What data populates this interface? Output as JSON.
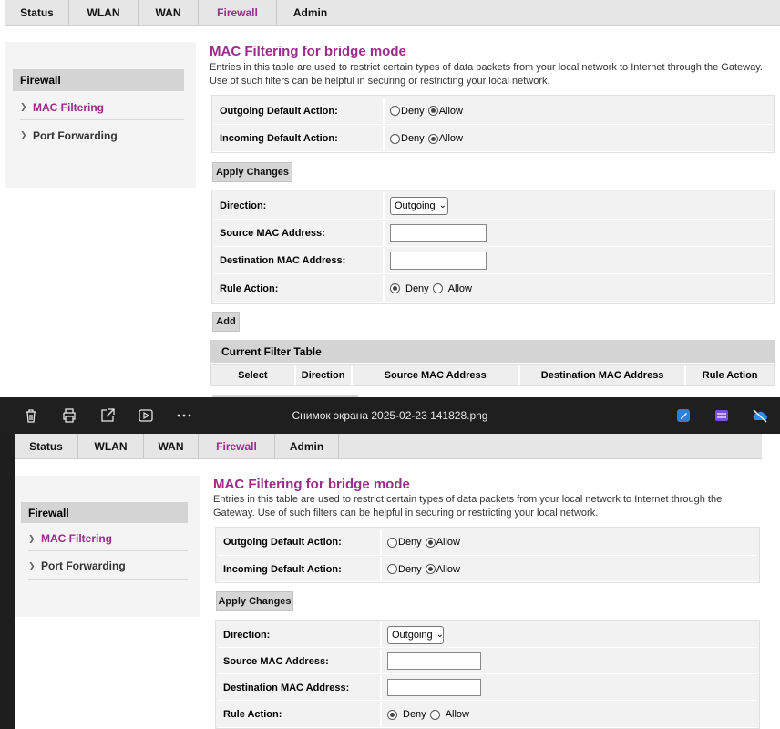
{
  "nav": {
    "tabs": [
      "Status",
      "WLAN",
      "WAN",
      "Firewall",
      "Admin"
    ],
    "active": "Firewall"
  },
  "sidebar": {
    "header": "Firewall",
    "items": [
      {
        "label": "MAC Filtering",
        "active": true
      },
      {
        "label": "Port Forwarding",
        "active": false
      }
    ]
  },
  "page": {
    "title": "MAC Filtering for bridge mode",
    "description": "Entries in this table are used to restrict certain types of data packets from your local network to Internet through the Gateway. Use of such filters can be helpful in securing or restricting your local network."
  },
  "defaults": {
    "outgoing_label": "Outgoing Default Action:",
    "incoming_label": "Incoming Default Action:",
    "deny": "Deny",
    "allow": "Allow",
    "outgoing_value": "Allow",
    "incoming_value": "Allow",
    "apply_button": "Apply Changes"
  },
  "rule_form": {
    "direction_label": "Direction:",
    "direction_value": "Outgoing",
    "source_label": "Source MAC Address:",
    "source_value": "",
    "dest_label": "Destination MAC Address:",
    "dest_value": "",
    "action_label": "Rule Action:",
    "deny": "Deny",
    "allow": "Allow",
    "action_value": "Deny",
    "add_button": "Add"
  },
  "filter_table": {
    "title": "Current Filter Table",
    "columns": [
      "Select",
      "Direction",
      "Source MAC Address",
      "Destination MAC Address",
      "Rule Action"
    ]
  },
  "viewer": {
    "file_title": "Снимок экрана 2025-02-23 141828.png",
    "icons": [
      "trash-icon",
      "print-icon",
      "share-icon",
      "slideshow-icon",
      "more-icon",
      "edit-icon",
      "clipchamp-icon",
      "onedrive-icon"
    ]
  },
  "colors": {
    "accent": "#9b2c8a",
    "toolbar_bg": "#1f1f1f",
    "panel_bg": "#f2f2f2"
  }
}
